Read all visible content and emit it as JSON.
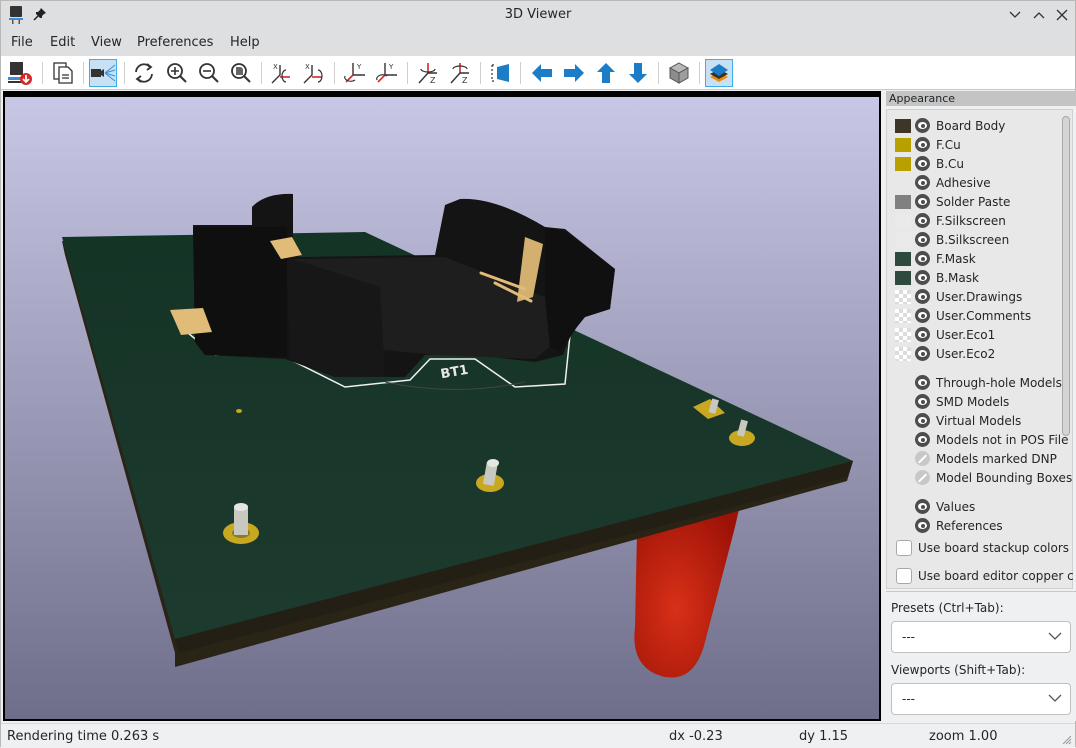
{
  "window": {
    "title": "3D Viewer",
    "controls": {
      "minimize": "minimize",
      "maximize": "maximize",
      "close": "close"
    }
  },
  "menubar": [
    "File",
    "Edit",
    "View",
    "Preferences",
    "Help"
  ],
  "toolbar": {
    "buttons": [
      {
        "name": "export-image",
        "icon": "export-image-icon"
      },
      {
        "name": "copy-to-clipboard",
        "icon": "copy-icon"
      },
      {
        "name": "raytracing",
        "icon": "camera-render-icon",
        "active": true
      },
      {
        "name": "reload",
        "icon": "refresh-icon"
      },
      {
        "name": "zoom-in",
        "icon": "zoom-in-icon"
      },
      {
        "name": "zoom-out",
        "icon": "zoom-out-icon"
      },
      {
        "name": "zoom-fit",
        "icon": "zoom-fit-icon"
      },
      {
        "name": "rotate-x-cw",
        "icon": "rotate-x-cw-icon"
      },
      {
        "name": "rotate-x-ccw",
        "icon": "rotate-x-ccw-icon"
      },
      {
        "name": "rotate-y-cw",
        "icon": "rotate-y-cw-icon"
      },
      {
        "name": "rotate-y-ccw",
        "icon": "rotate-y-ccw-icon"
      },
      {
        "name": "rotate-z-cw",
        "icon": "rotate-z-cw-icon"
      },
      {
        "name": "rotate-z-ccw",
        "icon": "rotate-z-ccw-icon"
      },
      {
        "name": "flip-board",
        "icon": "flip-board-icon"
      },
      {
        "name": "move-left",
        "icon": "arrow-left-icon"
      },
      {
        "name": "move-right",
        "icon": "arrow-right-icon"
      },
      {
        "name": "move-up",
        "icon": "arrow-up-icon"
      },
      {
        "name": "move-down",
        "icon": "arrow-down-icon"
      },
      {
        "name": "toggle-orthographic",
        "icon": "cube-icon"
      },
      {
        "name": "toggle-appearance-panel",
        "icon": "layers-icon",
        "active": true
      }
    ]
  },
  "viewport": {
    "reference_label": "BT1",
    "background_top": "#c8c8e6",
    "background_bottom": "#6e6e8a",
    "board_color": "#17362a",
    "board_edge_color": "#2a2518",
    "component_color": "#151515",
    "copper_color": "#c8a820",
    "pad_color": "#e0bc78",
    "led_color": "#b01808"
  },
  "appearance": {
    "header": "Appearance",
    "layers": [
      {
        "label": "Board Body",
        "swatch": "#3d3528",
        "visible": true
      },
      {
        "label": "F.Cu",
        "swatch": "#b8a000",
        "visible": true
      },
      {
        "label": "B.Cu",
        "swatch": "#b8a000",
        "visible": true
      },
      {
        "label": "Adhesive",
        "swatch": null,
        "visible": true
      },
      {
        "label": "Solder Paste",
        "swatch": "#808080",
        "visible": true
      },
      {
        "label": "F.Silkscreen",
        "swatch": "#eaeaea",
        "visible": true
      },
      {
        "label": "B.Silkscreen",
        "swatch": "#eaeaea",
        "visible": true
      },
      {
        "label": "F.Mask",
        "swatch": "#2e4a3e",
        "visible": true
      },
      {
        "label": "B.Mask",
        "swatch": "#2e4a3e",
        "visible": true
      },
      {
        "label": "User.Drawings",
        "swatch": "checker",
        "visible": true
      },
      {
        "label": "User.Comments",
        "swatch": "checker",
        "visible": true
      },
      {
        "label": "User.Eco1",
        "swatch": "checker",
        "visible": true
      },
      {
        "label": "User.Eco2",
        "swatch": "checker",
        "visible": true
      }
    ],
    "models": [
      {
        "label": "Through-hole Models",
        "visible": true
      },
      {
        "label": "SMD Models",
        "visible": true
      },
      {
        "label": "Virtual Models",
        "visible": true
      },
      {
        "label": "Models not in POS File",
        "visible": true
      },
      {
        "label": "Models marked DNP",
        "visible": false
      },
      {
        "label": "Model Bounding Boxes",
        "visible": false
      }
    ],
    "text_items": [
      {
        "label": "Values",
        "visible": true
      },
      {
        "label": "References",
        "visible": true
      }
    ],
    "checkboxes": [
      {
        "label": "Use board stackup colors",
        "checked": false
      },
      {
        "label": "Use board editor copper colors",
        "checked": false
      }
    ],
    "presets_label": "Presets (Ctrl+Tab):",
    "presets_value": "---",
    "viewports_label": "Viewports (Shift+Tab):",
    "viewports_value": "---"
  },
  "statusbar": {
    "rendering": "Rendering time 0.263 s",
    "dx": "dx -0.23",
    "dy": "dy 1.15",
    "zoom": "zoom 1.00"
  }
}
